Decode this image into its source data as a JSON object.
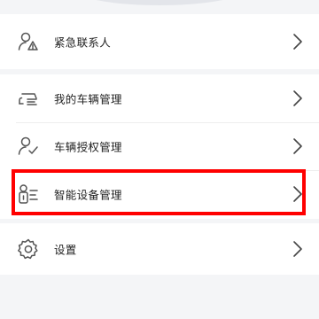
{
  "menu": {
    "items": [
      {
        "label": "紧急联系人",
        "icon": "emergency-contact-icon"
      },
      {
        "label": "我的车辆管理",
        "icon": "car-icon"
      },
      {
        "label": "车辆授权管理",
        "icon": "user-authorize-icon"
      },
      {
        "label": "智能设备管理",
        "icon": "smart-device-icon"
      },
      {
        "label": "设置",
        "icon": "gear-icon"
      }
    ],
    "highlighted_index": 3
  },
  "colors": {
    "highlight": "#ff0000",
    "icon": "#555555",
    "chevron": "#444444",
    "background": "#f4f5f7",
    "card": "#ffffff"
  }
}
